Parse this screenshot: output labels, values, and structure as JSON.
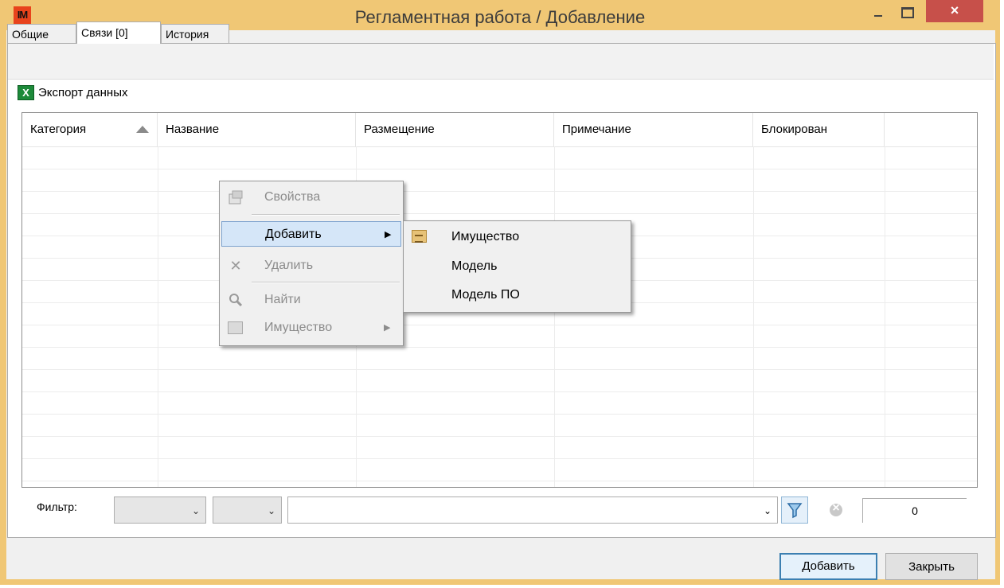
{
  "window": {
    "app_icon_text": "IM",
    "title": "Регламентная работа / Добавление",
    "close_glyph": "×"
  },
  "tabs": [
    {
      "label": "Общие",
      "active": false
    },
    {
      "label": "Связи [0]",
      "active": true
    },
    {
      "label": "История",
      "active": false
    }
  ],
  "toolbar": {
    "export_label": "Экспорт данных",
    "export_icon": "excel-icon",
    "export_icon_glyph": "X"
  },
  "grid": {
    "columns": [
      {
        "label": "Категория",
        "sorted": "ascending"
      },
      {
        "label": "Название"
      },
      {
        "label": "Размещение"
      },
      {
        "label": "Примечание"
      },
      {
        "label": "Блокирован"
      }
    ],
    "rows": []
  },
  "context_menu": {
    "items": [
      {
        "label": "Свойства",
        "enabled": false,
        "icon": "properties-icon"
      },
      {
        "label": "Добавить",
        "enabled": true,
        "highlighted": true,
        "has_submenu": true
      },
      {
        "label": "Удалить",
        "enabled": false,
        "icon": "delete-icon"
      },
      {
        "label": "Найти",
        "enabled": false,
        "icon": "search-icon"
      },
      {
        "label": "Имущество",
        "enabled": false,
        "icon": "folder-icon",
        "has_submenu": true
      }
    ],
    "submenu_arrow": "▶",
    "delete_glyph": "✕",
    "search_glyph": "⚲",
    "submenu": {
      "items": [
        {
          "label": "Имущество",
          "icon": "folder-icon"
        },
        {
          "label": "Модель"
        },
        {
          "label": "Модель ПО"
        }
      ]
    }
  },
  "filter": {
    "label": "Фильтр:",
    "combo1_value": "",
    "combo2_value": "",
    "text_value": "",
    "dropdown_glyph": "⌄",
    "count": "0"
  },
  "buttons": {
    "add_label": "Добавить",
    "close_label": "Закрыть"
  },
  "colors": {
    "title_bar": "#f0c775",
    "close_button": "#c7504a",
    "menu_highlight": "#d5e6f8"
  }
}
